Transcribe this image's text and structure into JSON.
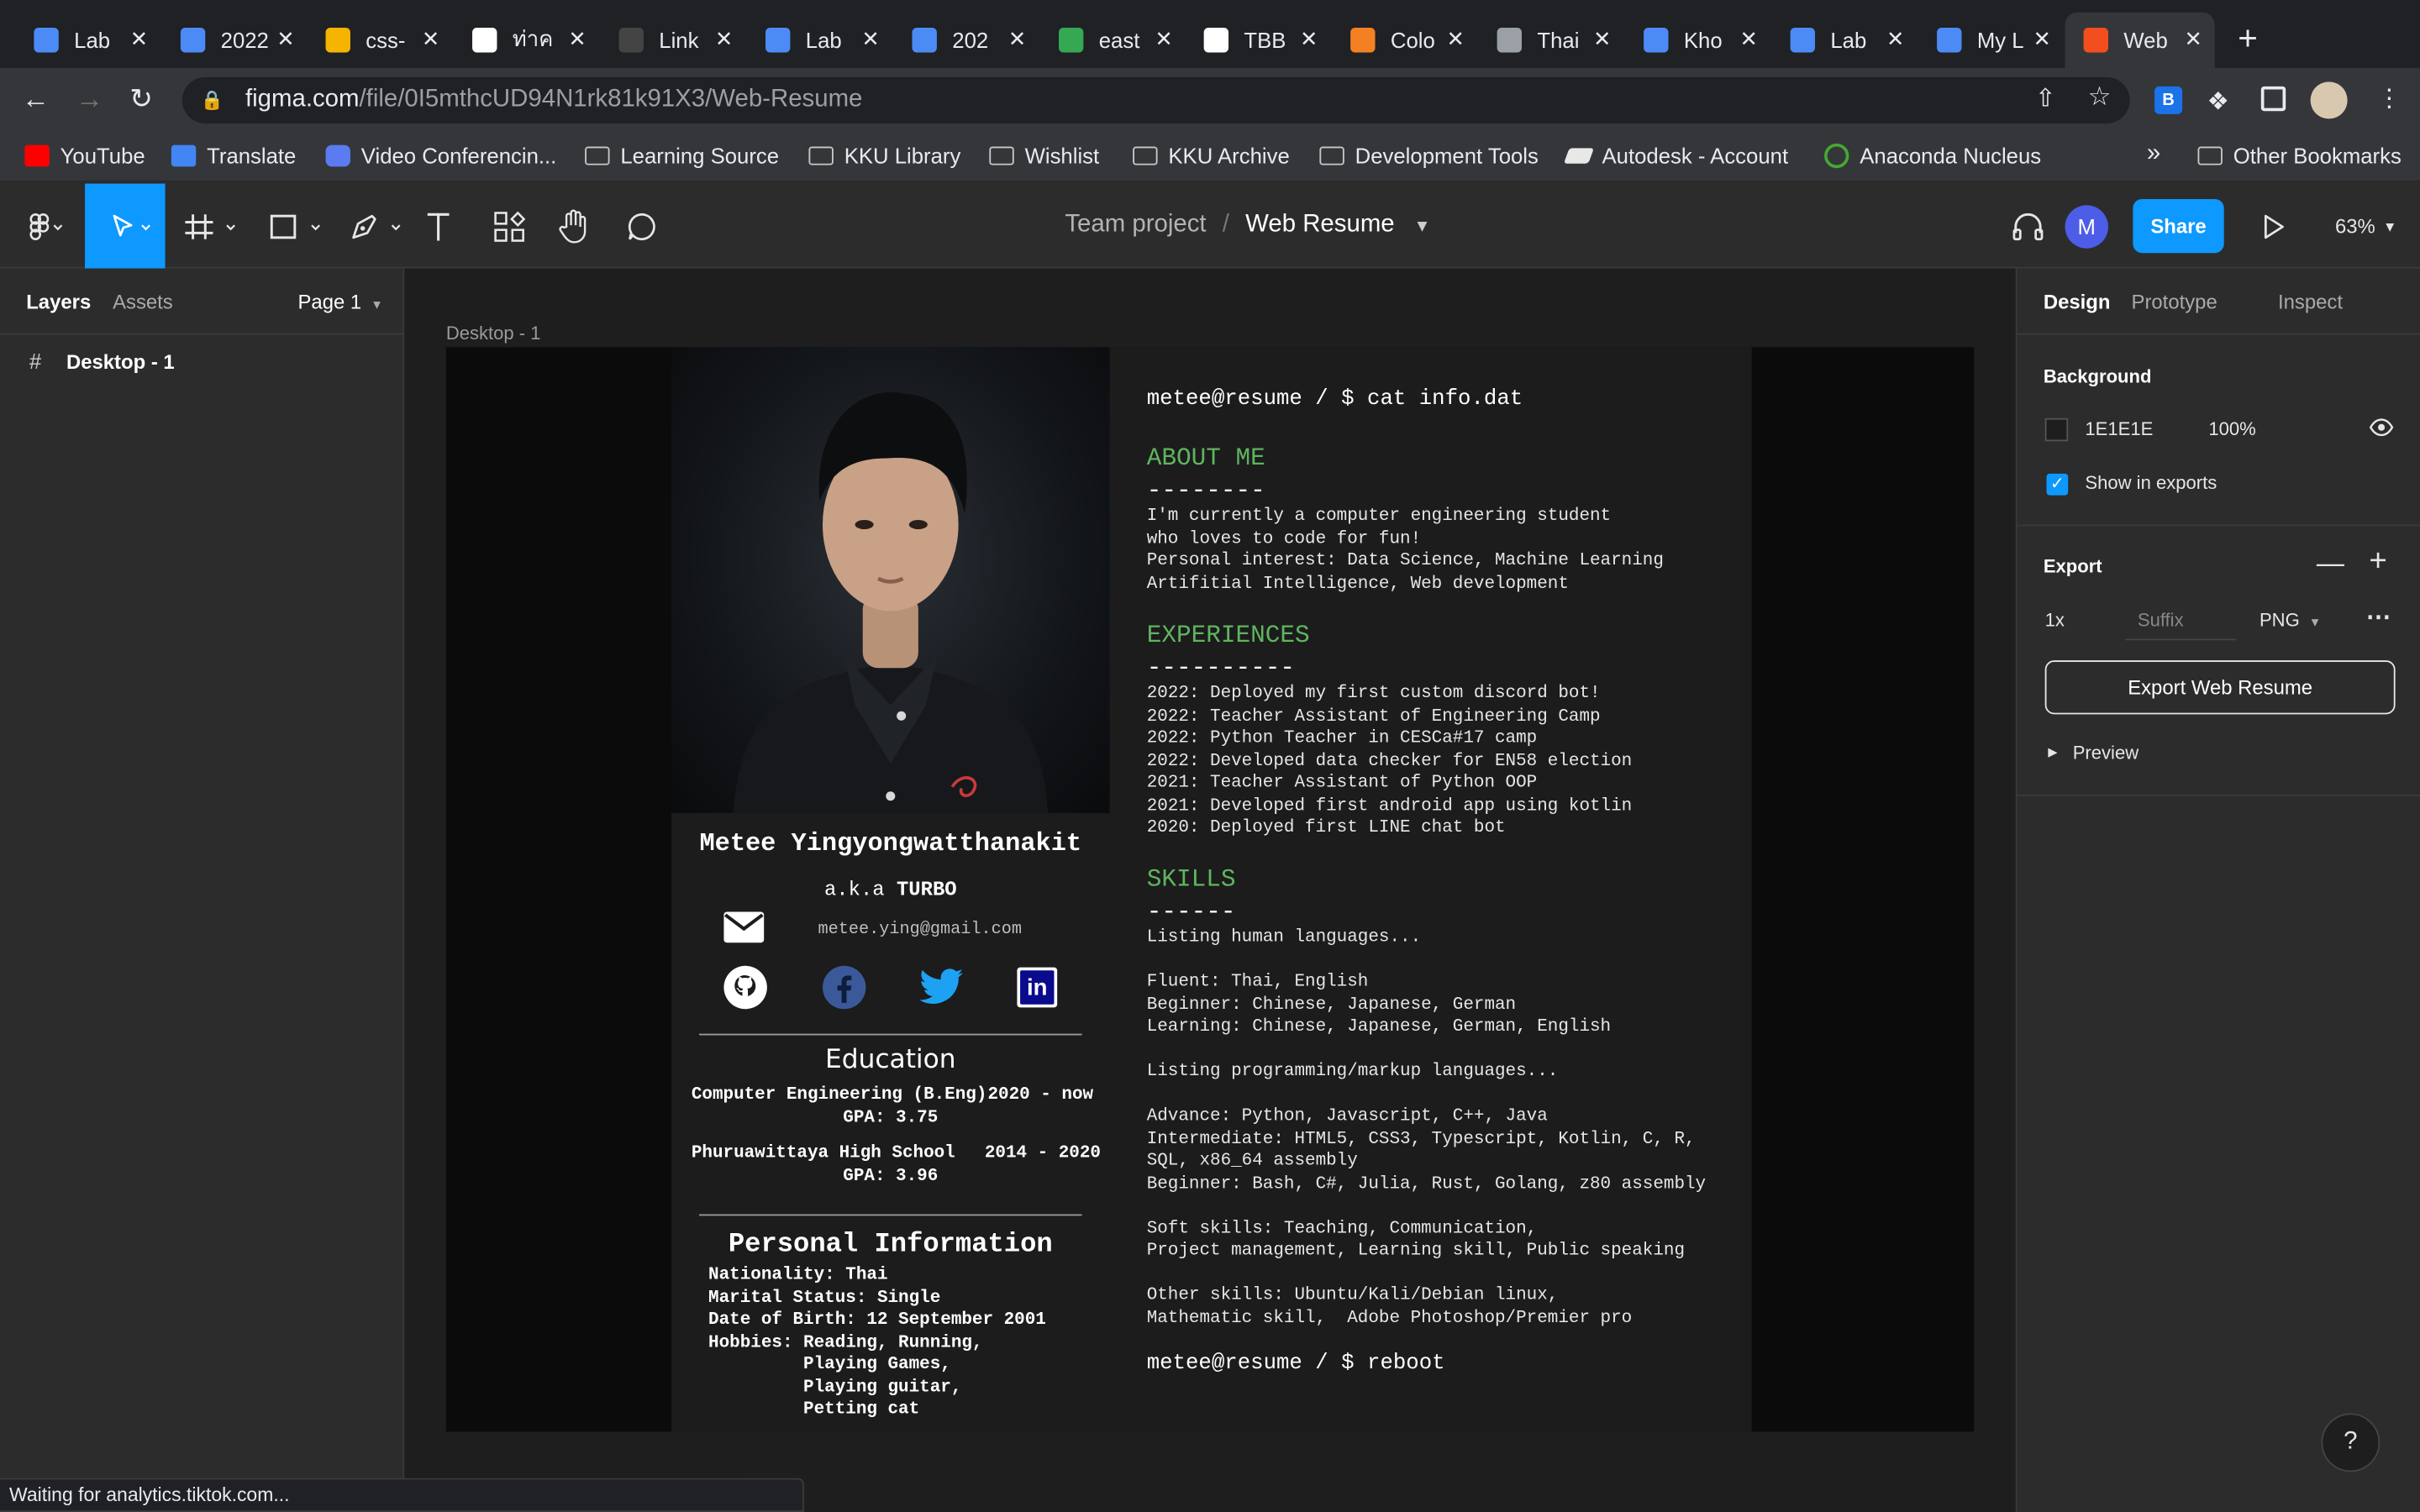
{
  "browser": {
    "tabs": [
      {
        "title": "Lab",
        "color": "#4c8bf5"
      },
      {
        "title": "2022",
        "color": "#4c8bf5"
      },
      {
        "title": "css-",
        "color": "#f4b400"
      },
      {
        "title": "ท่าค",
        "color": "#ffffff"
      },
      {
        "title": "Link",
        "color": "#444444"
      },
      {
        "title": "Lab",
        "color": "#4c8bf5"
      },
      {
        "title": "202",
        "color": "#4c8bf5"
      },
      {
        "title": "east",
        "color": "#34a853"
      },
      {
        "title": "TBB",
        "color": "#ffffff"
      },
      {
        "title": "Colo",
        "color": "#f48024"
      },
      {
        "title": "Thai",
        "color": "#9aa0a6"
      },
      {
        "title": "Kho",
        "color": "#4c8bf5"
      },
      {
        "title": "Lab",
        "color": "#4c8bf5"
      },
      {
        "title": "My L",
        "color": "#4c8bf5"
      },
      {
        "title": "Web",
        "color": "#f24e1e"
      }
    ],
    "url_host": "figma.com",
    "url_path": "/file/0I5mthcUD94N1rk81k91X3/Web-Resume",
    "bookmarks": [
      "YouTube",
      "Translate",
      "Video Conferencin...",
      "Learning Source",
      "KKU Library",
      "Wishlist",
      "KKU Archive",
      "Development Tools",
      "Autodesk - Account",
      "Anaconda Nucleus"
    ],
    "bookmarks_overflow": "»",
    "other_bookmarks": "Other Bookmarks",
    "status": "Waiting for analytics.tiktok.com..."
  },
  "figma": {
    "project": "Team project",
    "separator": "/",
    "file": "Web Resume",
    "avatar": "M",
    "share": "Share",
    "zoom": "63%",
    "left_tabs": [
      "Layers",
      "Assets"
    ],
    "page": "Page 1",
    "layer": "Desktop - 1",
    "frame_label": "Desktop - 1",
    "right_tabs": [
      "Design",
      "Prototype",
      "Inspect"
    ],
    "background_title": "Background",
    "bg_hex": "1E1E1E",
    "bg_opacity": "100%",
    "show_exports": "Show in exports",
    "export_title": "Export",
    "export_scale": "1x",
    "export_suffix": "Suffix",
    "export_format": "PNG",
    "export_button": "Export Web Resume",
    "preview": "Preview",
    "help": "?"
  },
  "resume": {
    "name": "Metee Yingyongwatthanakit",
    "aka_prefix": "a.k.a",
    "aka": "TURBO",
    "email": "metee.ying@gmail.com",
    "education_title": "Education",
    "edu": [
      {
        "school": "Computer Engineering (B.Eng)",
        "years": "2020 - now",
        "gpa": "GPA: 3.75"
      },
      {
        "school": "Phuruawittaya High School",
        "years": "2014 - 2020",
        "gpa": "GPA: 3.96"
      }
    ],
    "personal_title": "Personal Information",
    "personal": [
      "Nationality: Thai",
      "Marital Status: Single",
      "Date of Birth: 12 September 2001",
      "Hobbies: Reading, Running,",
      "         Playing Games,",
      "         Playing guitar,",
      "         Petting cat"
    ],
    "prompt": "metee@resume / $ cat info.dat",
    "about_title": "ABOUT ME",
    "about_rule": "--------",
    "about": [
      "I'm currently a computer engineering student",
      "who loves to code for fun!",
      "Personal interest: Data Science, Machine Learning",
      "Artifitial Intelligence, Web development"
    ],
    "exp_title": "EXPERIENCES",
    "exp_rule": "----------",
    "exp": [
      "2022: Deployed my first custom discord bot!",
      "2022: Teacher Assistant of Engineering Camp",
      "2022: Python Teacher in CESCa#17 camp",
      "2022: Developed data checker for EN58 election",
      "2021: Teacher Assistant of Python OOP",
      "2021: Developed first android app using kotlin",
      "2020: Deployed first LINE chat bot"
    ],
    "skills_title": "SKILLS",
    "skills_rule": "------",
    "skills": [
      "Listing human languages...",
      "",
      "Fluent: Thai, English",
      "Beginner: Chinese, Japanese, German",
      "Learning: Chinese, Japanese, German, English",
      "",
      "Listing programming/markup languages...",
      "",
      "Advance: Python, Javascript, C++, Java",
      "Intermediate: HTML5, CSS3, Typescript, Kotlin, C, R,",
      "SQL, x86_64 assembly",
      "Beginner: Bash, C#, Julia, Rust, Golang, z80 assembly",
      "",
      "Soft skills: Teaching, Communication,",
      "Project management, Learning skill, Public speaking",
      "",
      "Other skills: Ubuntu/Kali/Debian linux,",
      "Mathematic skill,  Adobe Photoshop/Premier pro"
    ],
    "end_prompt": "metee@resume / $ reboot"
  }
}
